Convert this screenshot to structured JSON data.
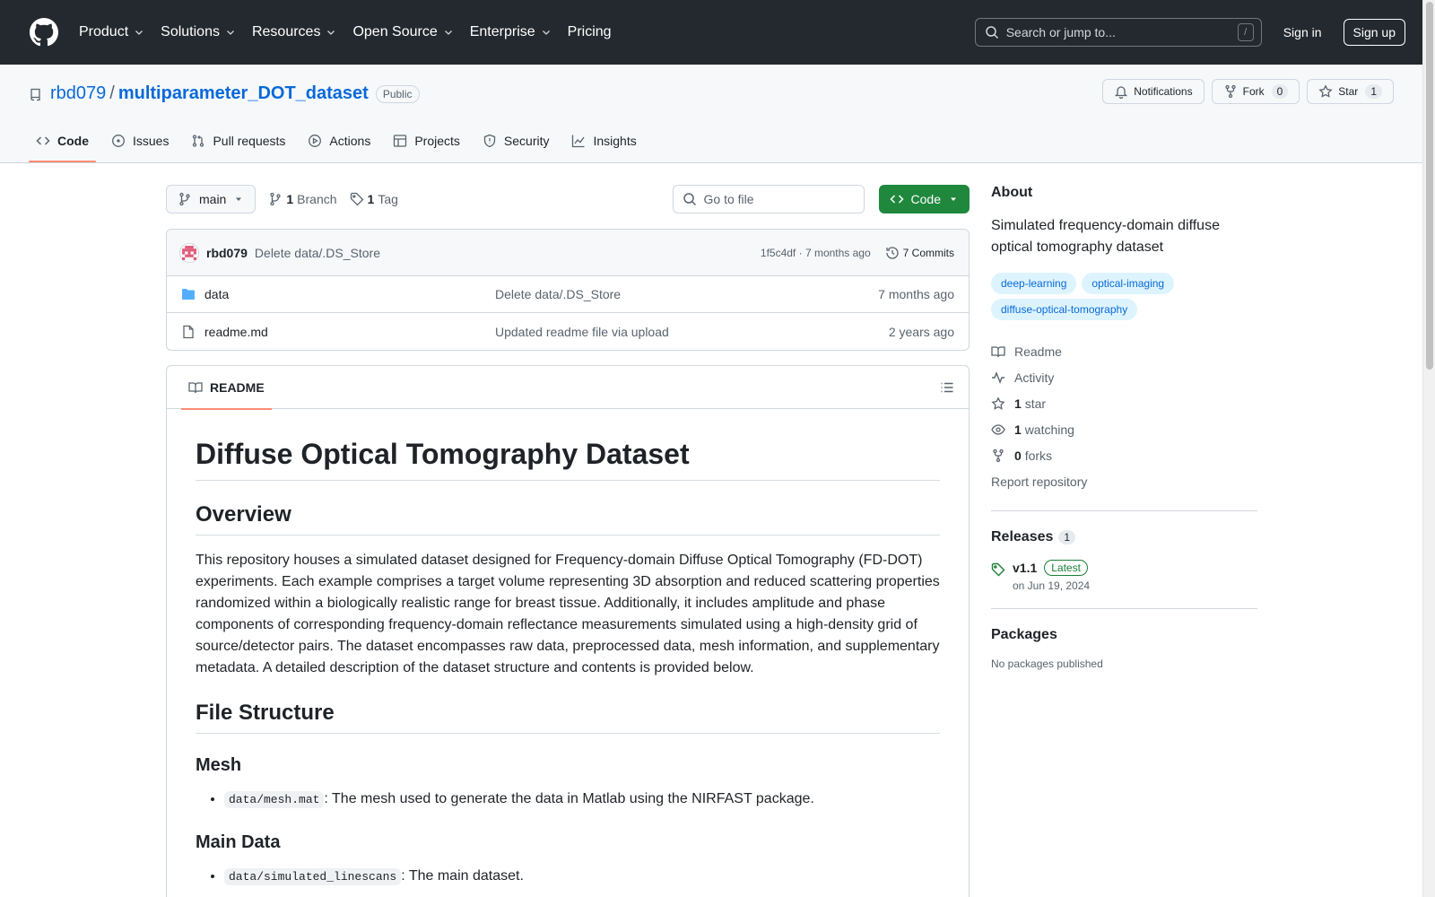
{
  "header": {
    "nav": [
      "Product",
      "Solutions",
      "Resources",
      "Open Source",
      "Enterprise",
      "Pricing"
    ],
    "search_placeholder": "Search or jump to...",
    "search_shortcut": "/",
    "signin": "Sign in",
    "signup": "Sign up"
  },
  "repo": {
    "owner": "rbd079",
    "separator": "/",
    "name": "multiparameter_DOT_dataset",
    "visibility": "Public",
    "notifications": "Notifications",
    "fork_label": "Fork",
    "fork_count": "0",
    "star_label": "Star",
    "star_count": "1",
    "tabs": [
      "Code",
      "Issues",
      "Pull requests",
      "Actions",
      "Projects",
      "Security",
      "Insights"
    ]
  },
  "toolbar": {
    "branch": "main",
    "branch_count": "1",
    "branch_label": "Branch",
    "tag_count": "1",
    "tag_label": "Tag",
    "goto_placeholder": "Go to file",
    "code_button": "Code"
  },
  "latest_commit": {
    "author": "rbd079",
    "message": "Delete data/.DS_Store",
    "hash": "1f5c4df",
    "time": "· 7 months ago",
    "commits": "7 Commits"
  },
  "files": [
    {
      "name": "data",
      "type": "folder",
      "commit": "Delete data/.DS_Store",
      "time": "7 months ago"
    },
    {
      "name": "readme.md",
      "type": "file",
      "commit": "Updated readme file via upload",
      "time": "2 years ago"
    }
  ],
  "readme": {
    "tab": "README",
    "h1": "Diffuse Optical Tomography Dataset",
    "overview_h": "Overview",
    "overview_p": "This repository houses a simulated dataset designed for Frequency-domain Diffuse Optical Tomography (FD-DOT) experiments. Each example comprises a target volume representing 3D absorption and reduced scattering properties randomized within a biologically realistic range for breast tissue. Additionally, it includes amplitude and phase components of corresponding frequency-domain reflectance measurements simulated using a high-density grid of source/detector pairs. The dataset encompasses raw data, preprocessed data, mesh information, and supplementary metadata. A detailed description of the dataset structure and contents is provided below.",
    "filestructure_h": "File Structure",
    "mesh_h": "Mesh",
    "mesh_code": "data/mesh.mat",
    "mesh_text": ": The mesh used to generate the data in Matlab using the NIRFAST package.",
    "main_h": "Main Data",
    "main_code": "data/simulated_linescans",
    "main_text": ": The main dataset."
  },
  "about": {
    "title": "About",
    "description": "Simulated frequency-domain diffuse optical tomography dataset",
    "topics": [
      "deep-learning",
      "optical-imaging",
      "diffuse-optical-tomography"
    ],
    "readme": "Readme",
    "activity": "Activity",
    "stars_count": "1",
    "stars_label": "star",
    "watching_count": "1",
    "watching_label": "watching",
    "forks_count": "0",
    "forks_label": "forks",
    "report": "Report repository"
  },
  "releases": {
    "title": "Releases",
    "count": "1",
    "version": "v1.1",
    "latest": "Latest",
    "date": "on Jun 19, 2024"
  },
  "packages": {
    "title": "Packages",
    "empty": "No packages published"
  },
  "colors": {
    "header_bg": "#24292f",
    "link": "#0969da",
    "green": "#1f883d",
    "tab_underline": "#fd8c73",
    "topic_bg": "#ddf4ff"
  }
}
